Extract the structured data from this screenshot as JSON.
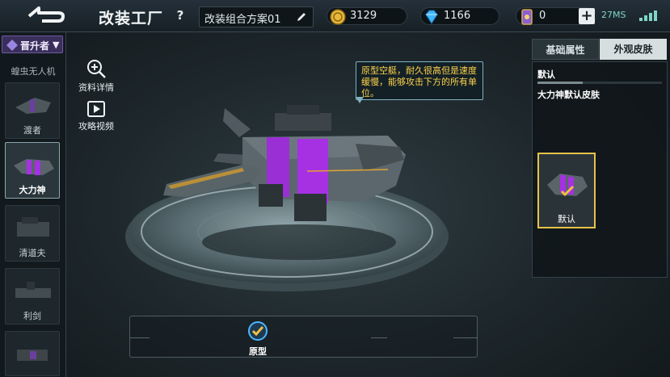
{
  "header": {
    "title": "改装工厂",
    "help": "?",
    "plan_name": "改装组合方案01",
    "gold": "3129",
    "gems": "1166",
    "cards": "0",
    "plus": "+",
    "network": "27MS",
    "colors": {
      "accent": "#7fd4c8",
      "gold": "#e8b83a",
      "gem": "#3fb6ff",
      "card": "#8a5fd0"
    }
  },
  "sidebar": {
    "role_label": "晋升者",
    "category": "蝗虫无人机",
    "items": [
      {
        "label": "渡者"
      },
      {
        "label": "大力神"
      },
      {
        "label": "清道夫"
      },
      {
        "label": "利剑"
      },
      {
        "label": ""
      }
    ]
  },
  "tools": {
    "details": "资料详情",
    "video": "攻略视频"
  },
  "tooltip": {
    "text": "原型空艇，耐久很高但是速度缓慢，能够攻击下方的所有单位。"
  },
  "right_panel": {
    "tab_basic": "基础属性",
    "tab_skin": "外观皮肤",
    "default_title": "默认",
    "skin_name": "大力神默认皮肤",
    "skin_card_label": "默认"
  },
  "bottom": {
    "label": "原型"
  }
}
